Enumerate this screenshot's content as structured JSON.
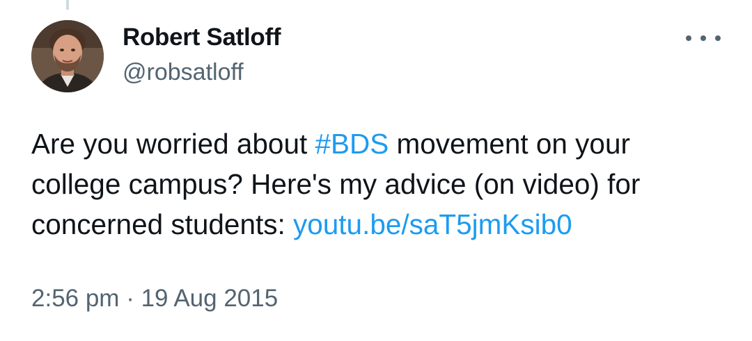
{
  "author": {
    "display_name": "Robert Satloff",
    "handle": "@robsatloff",
    "avatar_icon": "profile-photo"
  },
  "menu": {
    "icon": "more-horizontal-icon"
  },
  "tweet": {
    "lines": [
      {
        "pre": "Are you worried about ",
        "hashtag": "#BDS",
        "post": " movement on your"
      },
      {
        "text": "college campus? Here's my advice (on video) for"
      },
      {
        "pre": "concerned students: ",
        "link": "youtu.be/saT5jmKsib0"
      }
    ]
  },
  "meta": {
    "time": "2:56 pm",
    "separator": "·",
    "date": "19 Aug 2015"
  },
  "colors": {
    "text": "#0f1419",
    "secondary": "#536471",
    "link": "#1d9bf0",
    "thread_line": "#cfd9de"
  }
}
